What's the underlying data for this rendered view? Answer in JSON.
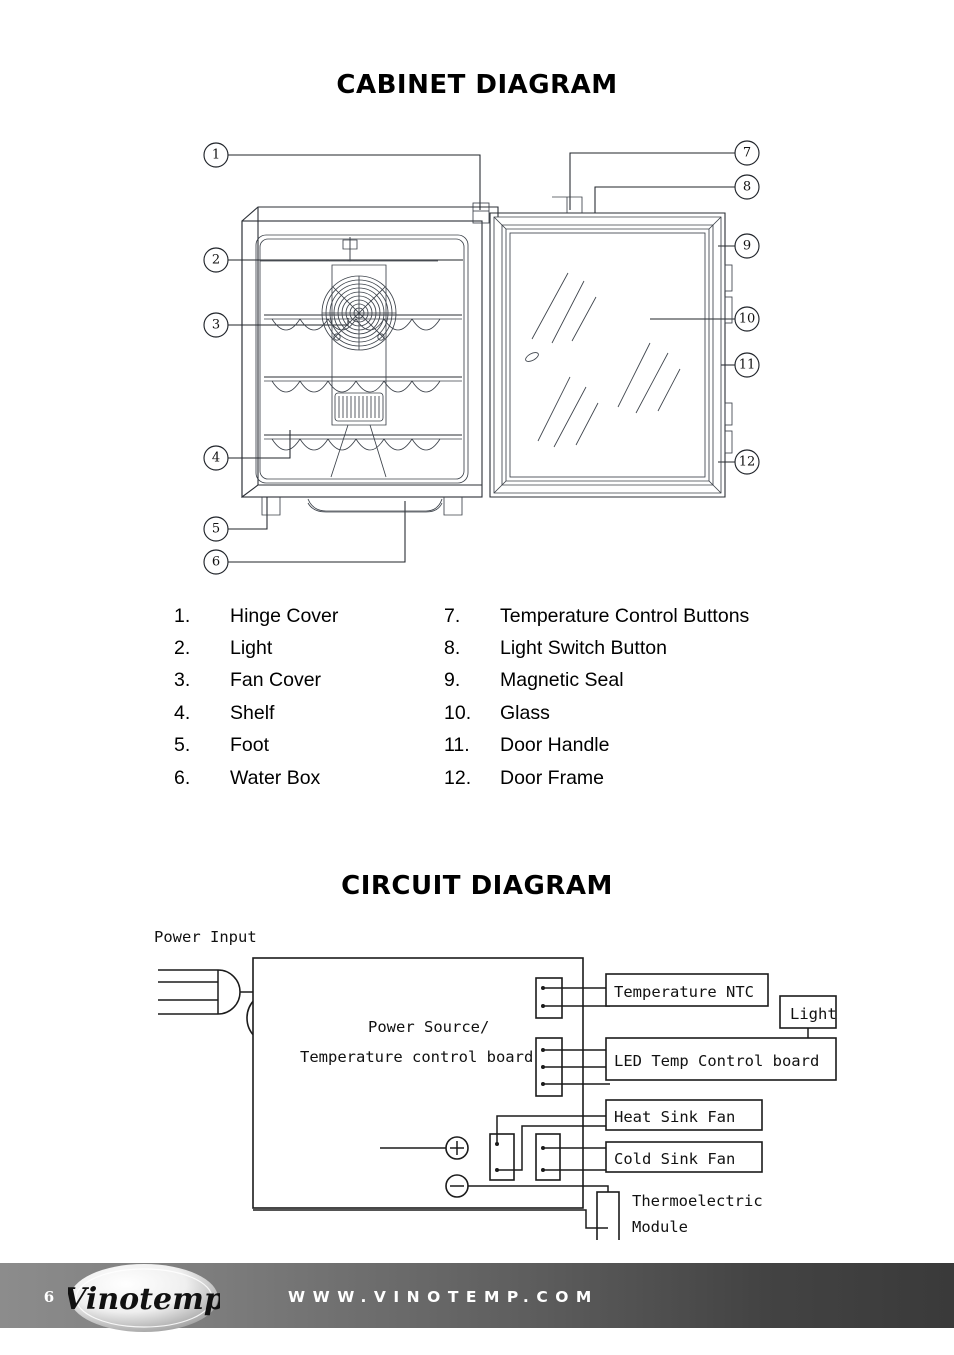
{
  "document": {
    "page_number": "6",
    "website": "WWW.VINOTEMP.COM",
    "brand": "Vinotemp"
  },
  "cabinet_section": {
    "title": "CABINET DIAGRAM",
    "callouts_left": [
      "1",
      "2",
      "3",
      "4",
      "5",
      "6"
    ],
    "callouts_right": [
      "7",
      "8",
      "9",
      "10",
      "11",
      "12"
    ],
    "parts_left": [
      {
        "num": "1.",
        "label": "Hinge Cover"
      },
      {
        "num": "2.",
        "label": "Light"
      },
      {
        "num": "3.",
        "label": "Fan Cover"
      },
      {
        "num": "4.",
        "label": "Shelf"
      },
      {
        "num": "5.",
        "label": "Foot"
      },
      {
        "num": "6.",
        "label": "Water Box"
      }
    ],
    "parts_right": [
      {
        "num": "7.",
        "label": "Temperature Control Buttons"
      },
      {
        "num": "8.",
        "label": "Light Switch Button"
      },
      {
        "num": "9.",
        "label": "Magnetic Seal"
      },
      {
        "num": "10.",
        "label": "Glass"
      },
      {
        "num": "11.",
        "label": "Door Handle"
      },
      {
        "num": "12.",
        "label": "Door Frame"
      }
    ]
  },
  "circuit_section": {
    "title": "CIRCUIT DIAGRAM",
    "power_input_label": "Power Input",
    "main_board_line1": "Power Source/",
    "main_board_line2": "Temperature control board",
    "components": [
      {
        "id": "temperature-ntc",
        "label": "Temperature NTC"
      },
      {
        "id": "light",
        "label": "Light"
      },
      {
        "id": "led-temp-control-board",
        "label": "LED Temp Control board"
      },
      {
        "id": "heat-sink-fan",
        "label": "Heat Sink Fan"
      },
      {
        "id": "cold-sink-fan",
        "label": "Cold Sink Fan"
      }
    ],
    "thermoelectric_line1": "Thermoelectric",
    "thermoelectric_line2": "Module",
    "terminal_positive": "+",
    "terminal_negative": "−"
  },
  "colors": {
    "ink": "#1b1b1b",
    "line": "#2b2f36",
    "footer_light": "#8c8c8c",
    "footer_dark": "#3a3a3a",
    "page_background": "#ffffff"
  }
}
